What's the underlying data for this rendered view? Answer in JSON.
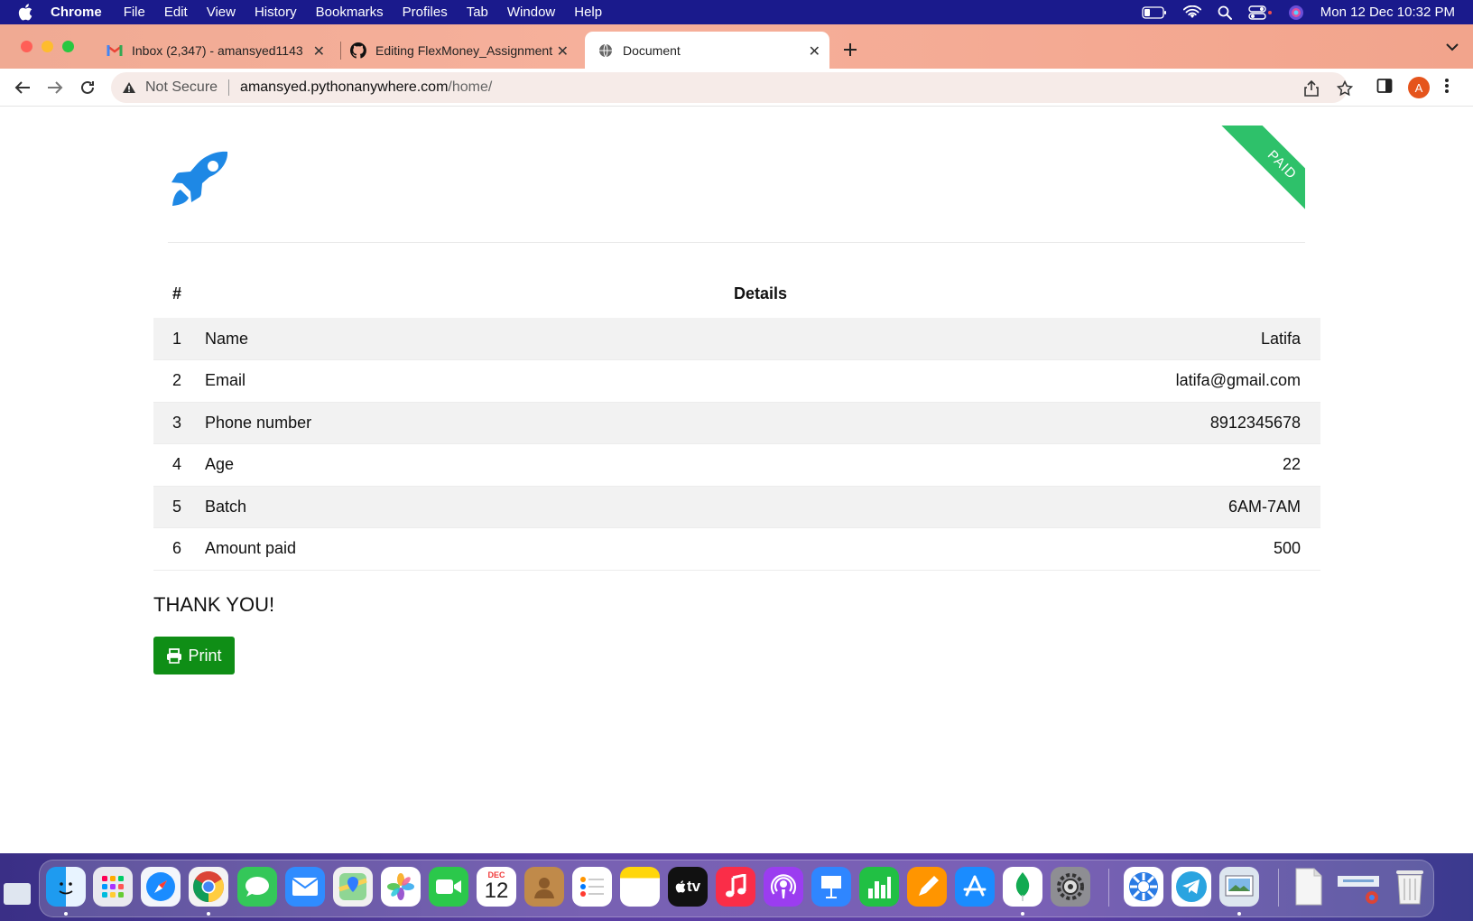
{
  "menubar": {
    "app": "Chrome",
    "items": [
      "File",
      "Edit",
      "View",
      "History",
      "Bookmarks",
      "Profiles",
      "Tab",
      "Window",
      "Help"
    ],
    "clock": "Mon 12 Dec  10:32 PM"
  },
  "tabs": [
    {
      "title": "Inbox (2,347) - amansyed1143",
      "icon": "gmail-icon"
    },
    {
      "title": "Editing FlexMoney_Assignment",
      "icon": "github-icon"
    },
    {
      "title": "Document",
      "icon": "globe-icon",
      "active": true
    }
  ],
  "address": {
    "security": "Not Secure",
    "host": "amansyed.pythonanywhere.com",
    "path": "/home/"
  },
  "profile_initial": "A",
  "page": {
    "ribbon": "PAID",
    "table": {
      "headers": [
        "#",
        "Details"
      ],
      "rows": [
        {
          "num": "1",
          "label": "Name",
          "value": "Latifa"
        },
        {
          "num": "2",
          "label": "Email",
          "value": "latifa@gmail.com"
        },
        {
          "num": "3",
          "label": "Phone number",
          "value": "8912345678"
        },
        {
          "num": "4",
          "label": "Age",
          "value": "22"
        },
        {
          "num": "5",
          "label": "Batch",
          "value": "6AM-7AM"
        },
        {
          "num": "6",
          "label": "Amount paid",
          "value": "500"
        }
      ]
    },
    "thanks": "THANK YOU!",
    "print_label": "Print"
  },
  "dock": {
    "calendar_month": "DEC",
    "calendar_day": "12",
    "tv_label": "tv"
  },
  "colors": {
    "menubar": "#1a1a8c",
    "ribbon": "#2ec16a",
    "print_button": "#0f8e16",
    "logo": "#1e88e5",
    "avatar": "#e5541c"
  }
}
